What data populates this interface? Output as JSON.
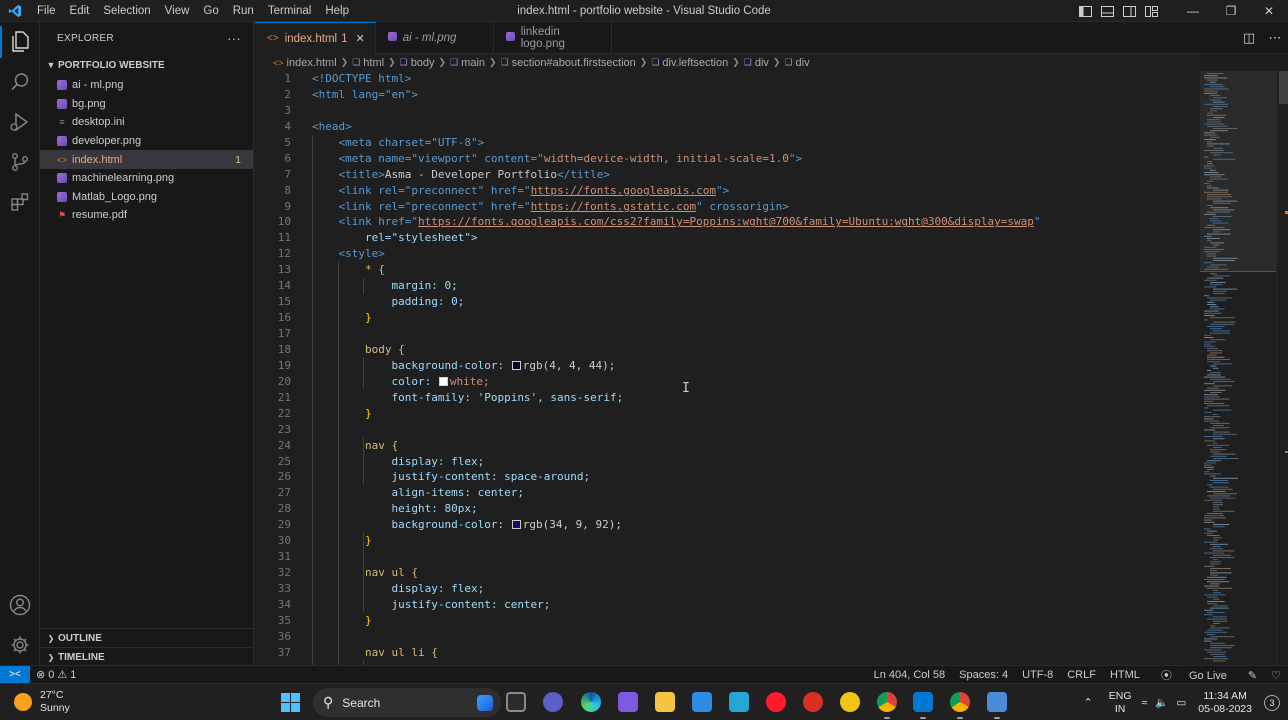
{
  "titlebar": {
    "menu": [
      "File",
      "Edit",
      "Selection",
      "View",
      "Go",
      "Run",
      "Terminal",
      "Help"
    ],
    "window_title": "index.html - portfolio website - Visual Studio Code"
  },
  "explorer": {
    "header": "EXPLORER",
    "more": "···",
    "folder": "PORTFOLIO WEBSITE",
    "files": [
      {
        "name": "ai - ml.png",
        "type": "image"
      },
      {
        "name": "bg.png",
        "type": "image"
      },
      {
        "name": "desktop.ini",
        "type": "settings"
      },
      {
        "name": "developer.png",
        "type": "image"
      },
      {
        "name": "index.html",
        "type": "html",
        "badge": "1"
      },
      {
        "name": "machinelearning.png",
        "type": "image"
      },
      {
        "name": "Matlab_Logo.png",
        "type": "image"
      },
      {
        "name": "resume.pdf",
        "type": "pdf"
      }
    ],
    "outline": "OUTLINE",
    "timeline": "TIMELINE"
  },
  "tabs": [
    {
      "label": "index.html",
      "badge": "1",
      "active": true
    },
    {
      "label": "ai - ml.png",
      "active": false
    },
    {
      "label": "linkedin logo.png",
      "active": false
    }
  ],
  "breadcrumb": [
    "index.html",
    "html",
    "body",
    "main",
    "section#about.firstsection",
    "div.leftsection",
    "div",
    "div"
  ],
  "editor": {
    "line_numbers": [
      "1",
      "2",
      "3",
      "4",
      "5",
      "6",
      "7",
      "8",
      "9",
      "10",
      "11",
      "12",
      "13",
      "14",
      "15",
      "16",
      "17",
      "18",
      "19",
      "20",
      "21",
      "22",
      "23",
      "24",
      "25",
      "26",
      "27",
      "28",
      "29",
      "30",
      "31",
      "32",
      "33",
      "34",
      "35",
      "36",
      "37"
    ],
    "code": {
      "l1": "<!DOCTYPE html>",
      "l2": "<html lang=\"en\">",
      "l4": "<head>",
      "l5": "<meta charset=\"UTF-8\">",
      "l6a": "<meta name=\"viewport\" content=\"",
      "l6b": "width=device-width, initial-scale=1.0",
      "l6c": "\">",
      "l7a": "<title>",
      "l7b": "Asma - Developer Portfolio",
      "l7c": "</title>",
      "l8a": "<link rel=\"preconnect\" href=\"",
      "l8b": "https://fonts.googleapis.com",
      "l8c": "\">",
      "l9a": "<link rel=\"preconnect\" href=\"",
      "l9b": "https://fonts.gstatic.com",
      "l9c": "\" crossorigin>",
      "l10a": "<link href=\"",
      "l10b": "https://fonts.googleapis.com/css2?family=Poppins:wght@700&family=Ubuntu:wght@300&display=swap",
      "l10c": "\"",
      "l11": "rel=\"stylesheet\">",
      "l12": "<style>",
      "l13": "* {",
      "l14": "margin: 0;",
      "l15": "padding: 0;",
      "l16": "}",
      "l18": "body {",
      "l19": "background-color: ",
      "l19v": "rgb(4, 4, 44);",
      "l20": "color: ",
      "l20v": "white;",
      "l21": "font-family: 'Poppins', sans-serif;",
      "l22": "}",
      "l24": "nav {",
      "l25": "display: flex;",
      "l26": "justify-content: space-around;",
      "l27": "align-items: center;",
      "l28": "height: 80px;",
      "l29": "background-color: ",
      "l29v": "rgb(34, 9, 92);",
      "l30": "}",
      "l32": "nav ul {",
      "l33": "display: flex;",
      "l34": "justify-content: center;",
      "l35": "}",
      "l37": "nav ul li {"
    },
    "swatches": {
      "body_bg": "#04042c",
      "white": "#ffffff",
      "nav_bg": "#22095c"
    }
  },
  "statusbar": {
    "errors": "0",
    "warnings": "1",
    "position": "Ln 404, Col 58",
    "spaces": "Spaces: 4",
    "encoding": "UTF-8",
    "eol": "CRLF",
    "language": "HTML",
    "golive": "Go Live"
  },
  "taskbar": {
    "temperature": "27°C",
    "condition": "Sunny",
    "search": "Search",
    "lang1": "ENG",
    "lang2": "IN",
    "time": "11:34 AM",
    "date": "05-08-2023",
    "notifications": "3"
  },
  "colors": {
    "accent": "#0078d4",
    "modified": "#e8a98a"
  }
}
